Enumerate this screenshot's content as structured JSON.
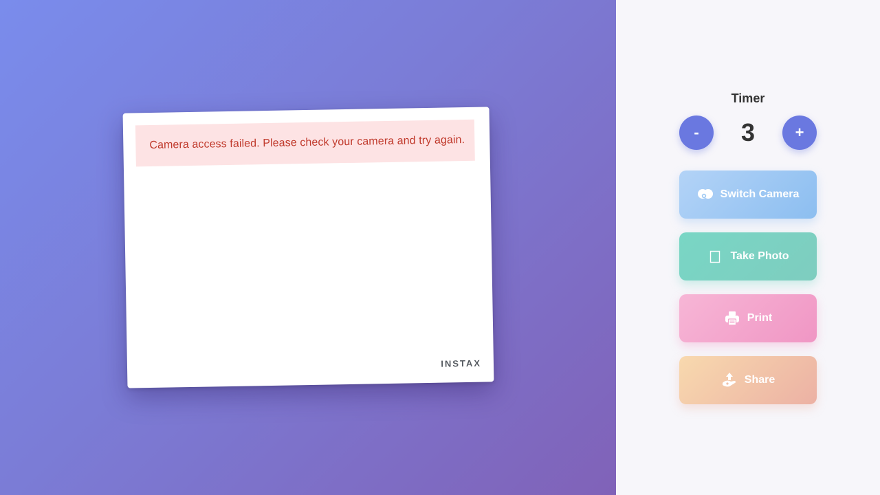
{
  "photo": {
    "error_message": "Camera access failed. Please check your camera and try again.",
    "brand": "INSTAX"
  },
  "timer": {
    "label": "Timer",
    "value": "3",
    "decrement_label": "-",
    "increment_label": "+"
  },
  "actions": {
    "switch_camera": {
      "label": "Switch Camera",
      "icon": "camera-switch-icon"
    },
    "take_photo": {
      "label": "Take Photo",
      "icon": "shutter-icon"
    },
    "print": {
      "label": "Print",
      "icon": "printer-icon"
    },
    "share": {
      "label": "Share",
      "icon": "share-icon"
    }
  },
  "colors": {
    "accent": "#6a78e0",
    "error_text": "#c0392b",
    "error_bg": "#fde3e4"
  }
}
